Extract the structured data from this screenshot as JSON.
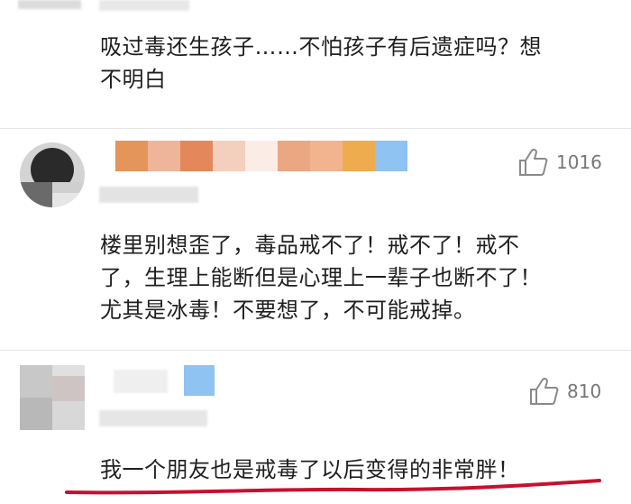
{
  "comments": [
    {
      "text_line1": "吸过毒还生孩子……不怕孩子有后遗症吗？想",
      "text_line2": "不明白"
    },
    {
      "likes": "1016",
      "text_line1": "楼里别想歪了，毒品戒不了！戒不了！戒不",
      "text_line2": "了，生理上能断但是心理上一辈子也断不了！",
      "text_line3": "尤其是冰毒！不要想了，不可能戒掉。"
    },
    {
      "likes": "810",
      "text_line1": "我一个朋友也是戒毒了以后变得的非常胖！"
    }
  ],
  "colors": {
    "underline": "#c8102e",
    "like_gray": "#777777",
    "pixel_blue": "#8fc3f2"
  }
}
